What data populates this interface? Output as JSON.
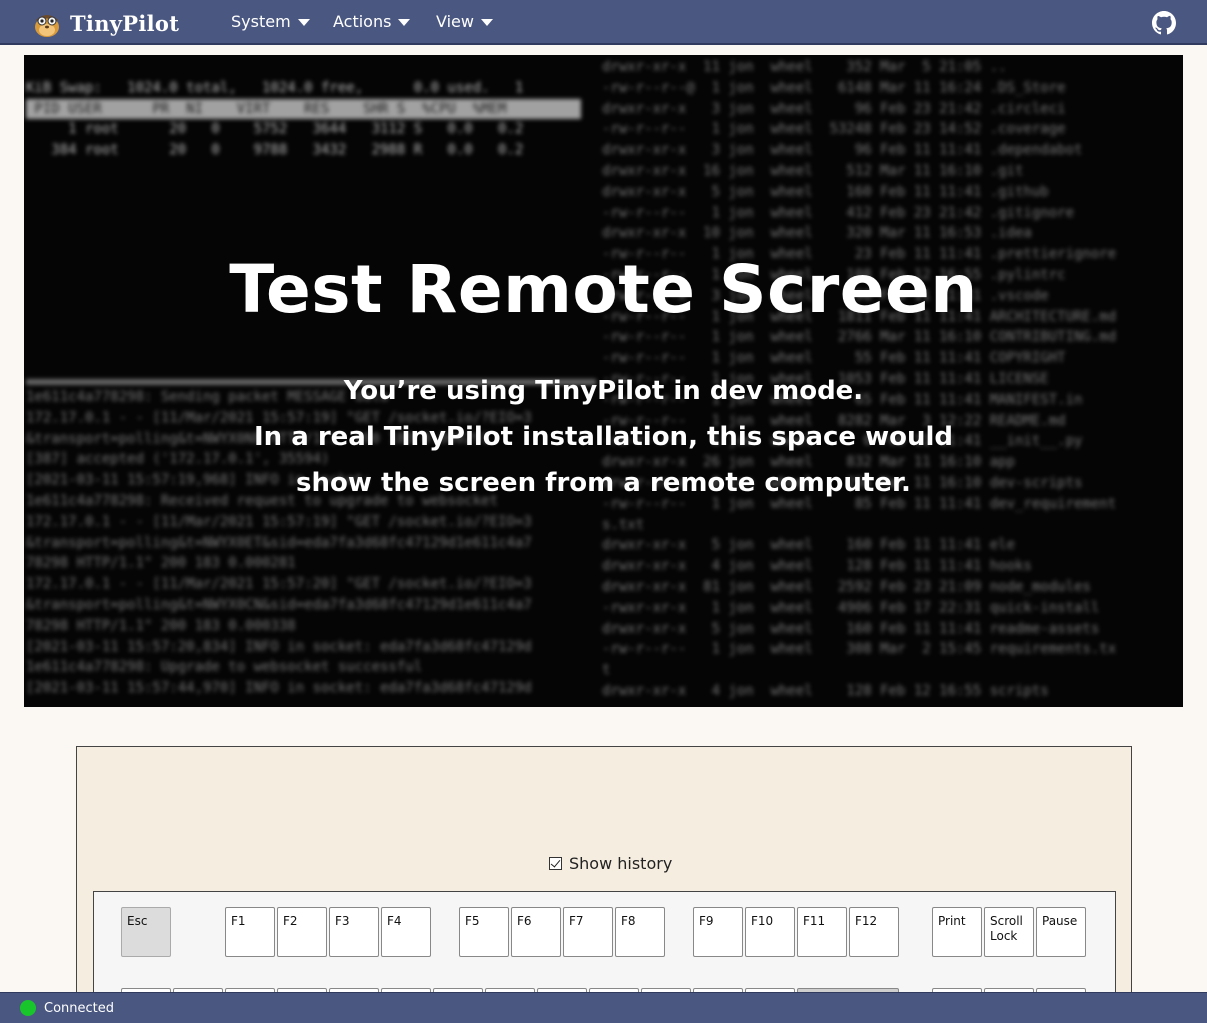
{
  "app": {
    "logo_text": "TinyPilot",
    "logo_icon": "pilot-mascot-icon"
  },
  "nav": {
    "menus": [
      {
        "label": "System"
      },
      {
        "label": "Actions"
      },
      {
        "label": "View"
      }
    ],
    "github_icon": "github-icon"
  },
  "screen": {
    "title": "Test Remote Screen",
    "message_lines": [
      "You’re using TinyPilot in dev mode.",
      "In a real TinyPilot installation, this space would",
      "show the screen from a remote computer."
    ]
  },
  "keyboard": {
    "show_history_label": "Show history",
    "show_history_checked": true,
    "keys_row1": [
      {
        "label": "Esc"
      },
      {
        "label": "F1"
      },
      {
        "label": "F2"
      },
      {
        "label": "F3"
      },
      {
        "label": "F4"
      },
      {
        "label": "F5"
      },
      {
        "label": "F6"
      },
      {
        "label": "F7"
      },
      {
        "label": "F8"
      },
      {
        "label": "F9"
      },
      {
        "label": "F10"
      },
      {
        "label": "F11"
      },
      {
        "label": "F12"
      },
      {
        "label": "Print"
      },
      {
        "label": "Scroll Lock"
      },
      {
        "label": "Pause"
      }
    ]
  },
  "status": {
    "connection_text": "Connected",
    "connection_color": "#18c62c"
  },
  "colors": {
    "navbar": "#4a5781",
    "page_background": "#fbf8f3",
    "keyboard_panel": "#f5ede0"
  }
}
